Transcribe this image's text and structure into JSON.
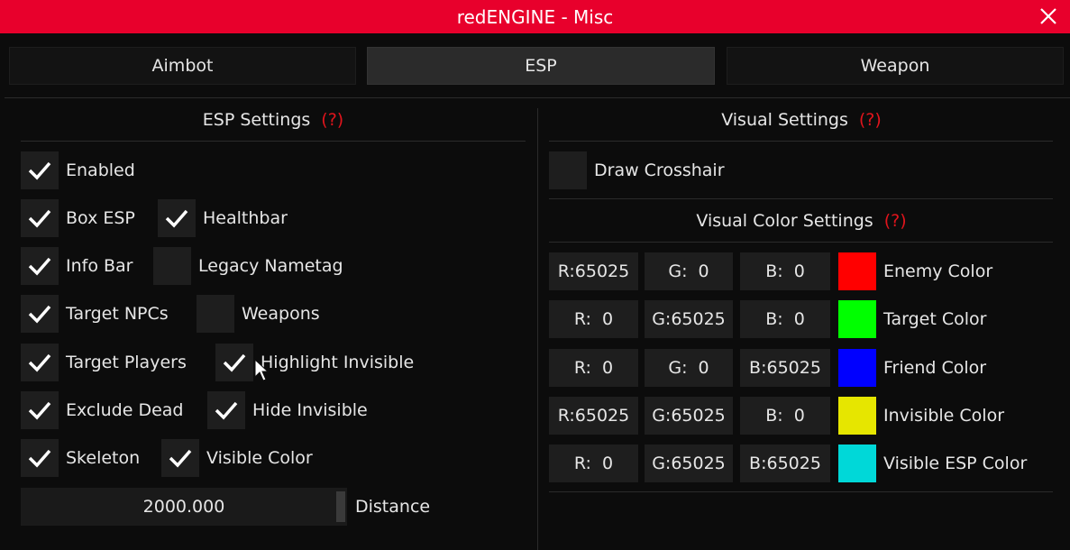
{
  "window": {
    "title": "redENGINE - Misc"
  },
  "tabs": [
    {
      "label": "Aimbot",
      "active": false
    },
    {
      "label": "ESP",
      "active": true
    },
    {
      "label": "Weapon",
      "active": false
    }
  ],
  "esp_settings": {
    "title": "ESP Settings",
    "help": "(?)",
    "checkboxes": [
      {
        "label": "Enabled",
        "checked": true
      },
      {
        "label": "Box ESP",
        "checked": true
      },
      {
        "label": "Healthbar",
        "checked": true
      },
      {
        "label": "Info Bar",
        "checked": true
      },
      {
        "label": "Legacy Nametag",
        "checked": false
      },
      {
        "label": "Target NPCs",
        "checked": true
      },
      {
        "label": "Weapons",
        "checked": false
      },
      {
        "label": "Target Players",
        "checked": true
      },
      {
        "label": "Highlight Invisible",
        "checked": true
      },
      {
        "label": "Exclude Dead",
        "checked": true
      },
      {
        "label": "Hide Invisible",
        "checked": true
      },
      {
        "label": "Skeleton",
        "checked": true
      },
      {
        "label": "Visible Color",
        "checked": true
      }
    ],
    "distance": {
      "value": "2000.000",
      "label": "Distance"
    }
  },
  "visual_settings": {
    "title": "Visual Settings",
    "help": "(?)",
    "draw_crosshair": {
      "label": "Draw Crosshair",
      "checked": false
    }
  },
  "visual_color_settings": {
    "title": "Visual Color Settings",
    "help": "(?)",
    "colors": [
      {
        "r": "R:65025",
        "g": "G:  0",
        "b": "B:  0",
        "label": "Enemy Color",
        "swatch": "#ff0000"
      },
      {
        "r": "R:  0",
        "g": "G:65025",
        "b": "B:  0",
        "label": "Target Color",
        "swatch": "#00ff00"
      },
      {
        "r": "R:  0",
        "g": "G:  0",
        "b": "B:65025",
        "label": "Friend Color",
        "swatch": "#0000ff"
      },
      {
        "r": "R:65025",
        "g": "G:65025",
        "b": "B:  0",
        "label": "Invisible Color",
        "swatch": "#e6e600"
      },
      {
        "r": "R:  0",
        "g": "G:65025",
        "b": "B:65025",
        "label": "Visible ESP Color",
        "swatch": "#00d8d8"
      }
    ]
  },
  "colors": {
    "titlebar": "#e8002c",
    "help": "#e0141c",
    "background": "#0c0c0c"
  }
}
